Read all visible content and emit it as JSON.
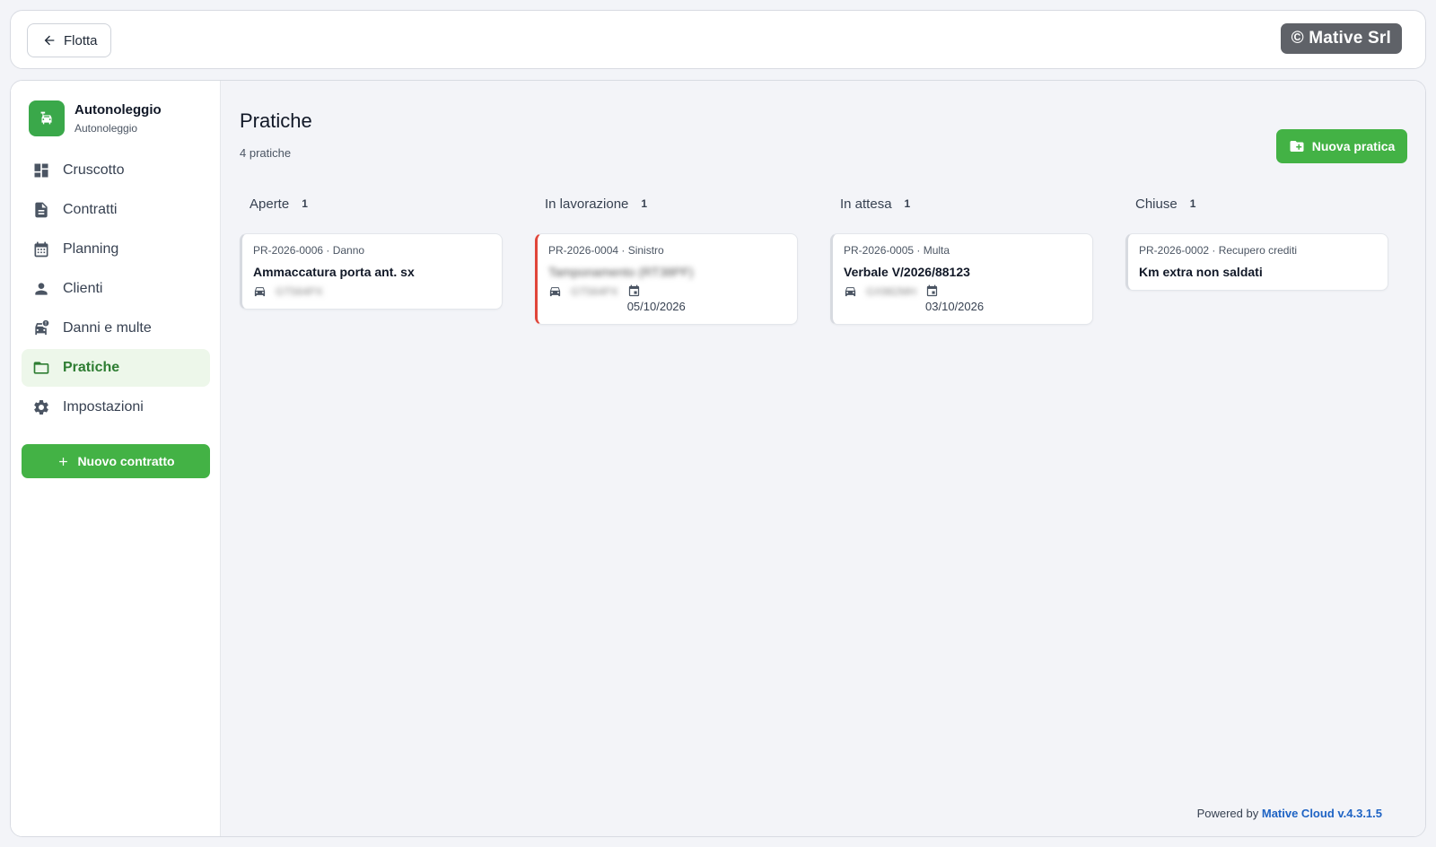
{
  "topbar": {
    "back_label": "Flotta",
    "brand_badge": "© Mative Srl"
  },
  "sidebar": {
    "brand_name": "Autonoleggio",
    "brand_sub": "Autonoleggio",
    "items": [
      {
        "label": "Cruscotto",
        "icon": "dashboard-icon"
      },
      {
        "label": "Contratti",
        "icon": "document-icon"
      },
      {
        "label": "Planning",
        "icon": "calendar-icon"
      },
      {
        "label": "Clienti",
        "icon": "person-icon"
      },
      {
        "label": "Danni e multe",
        "icon": "car-alert-icon"
      },
      {
        "label": "Pratiche",
        "icon": "folder-icon",
        "active": true
      },
      {
        "label": "Impostazioni",
        "icon": "gear-icon"
      }
    ],
    "new_contract_label": "Nuovo contratto"
  },
  "main": {
    "title": "Pratiche",
    "count": "4 pratiche",
    "new_button": "Nuova pratica",
    "columns": [
      {
        "name": "Aperte",
        "count": "1",
        "card": {
          "ref": "PR-2026-0006 · Danno",
          "title": "Ammaccatura porta ant. sx",
          "plate": "GT564PX",
          "date": ""
        }
      },
      {
        "name": "In lavorazione",
        "count": "1",
        "card": {
          "ref": "PR-2026-0004 · Sinistro",
          "title": "Tamponamento (RT38PF)",
          "plate": "GT564PX",
          "date": "05/10/2026"
        }
      },
      {
        "name": "In attesa",
        "count": "1",
        "card": {
          "ref": "PR-2026-0005 · Multa",
          "title": "Verbale V/2026/88123",
          "plate": "GX982MH",
          "date": "03/10/2026"
        }
      },
      {
        "name": "Chiuse",
        "count": "1",
        "card": {
          "ref": "PR-2026-0002 · Recupero crediti",
          "title": "Km extra non saldati",
          "plate": "",
          "date": ""
        }
      }
    ]
  },
  "footer": {
    "prefix": "Powered by",
    "link": "Mative Cloud v.4.3.1.5"
  },
  "colors": {
    "accent_green": "#43b245",
    "active_green": "#2e7d32",
    "urgent_red": "#e0453a",
    "link_blue": "#1e63c4"
  }
}
